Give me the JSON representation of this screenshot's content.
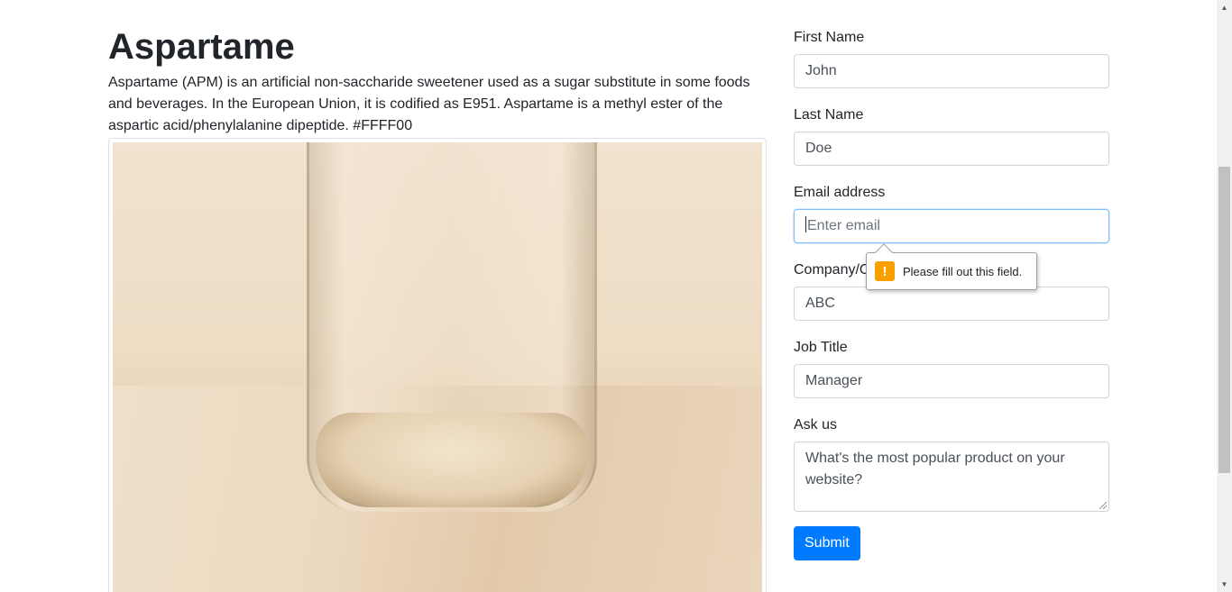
{
  "article": {
    "title": "Aspartame",
    "description": "Aspartame (APM) is an artificial non-saccharide sweetener used as a sugar substitute in some foods and beverages. In the European Union, it is codified as E951. Aspartame is a methyl ester of the aspartic acid/phenylalanine dipeptide. #FFFF00"
  },
  "form": {
    "first_name": {
      "label": "First Name",
      "value": "John"
    },
    "last_name": {
      "label": "Last Name",
      "value": "Doe"
    },
    "email": {
      "label": "Email address",
      "placeholder": "Enter email"
    },
    "company": {
      "label": "Company/Organization",
      "value": "ABC"
    },
    "job_title": {
      "label": "Job Title",
      "value": "Manager"
    },
    "ask_us": {
      "label": "Ask us",
      "value": "What's the most popular product on your website?"
    },
    "submit_label": "Submit"
  },
  "validation": {
    "icon": "warning-icon",
    "glyph": "!",
    "message": "Please fill out this field."
  },
  "colors": {
    "primary": "#007bff",
    "warning": "#f7a000",
    "focus_border": "#80bdff"
  }
}
